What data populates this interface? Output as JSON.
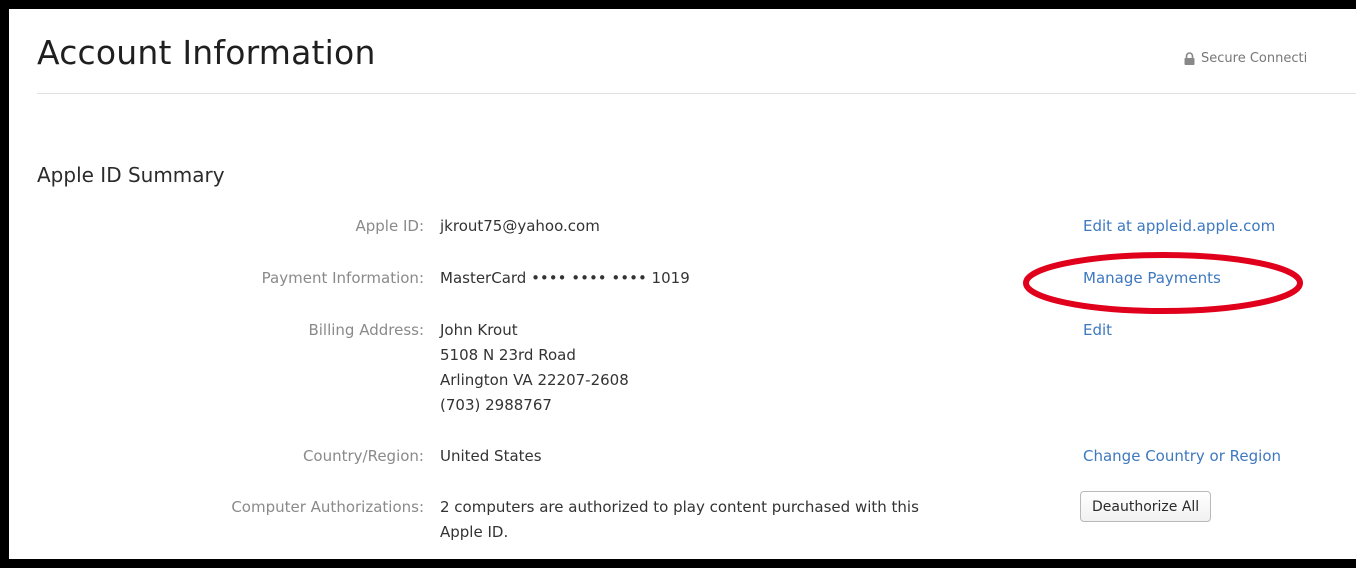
{
  "header": {
    "title": "Account Information",
    "secure_label": "Secure Connecti"
  },
  "summary": {
    "title": "Apple ID Summary",
    "rows": [
      {
        "label": "Apple ID:",
        "value": "jkrout75@yahoo.com",
        "action": "Edit at appleid.apple.com"
      },
      {
        "label": "Payment Information:",
        "value": "MasterCard •••• •••• •••• 1019",
        "action": "Manage Payments"
      },
      {
        "label": "Billing Address:",
        "value_lines": [
          "John Krout",
          "5108 N 23rd Road",
          "Arlington VA 22207-2608",
          "(703) 2988767"
        ],
        "action": "Edit"
      },
      {
        "label": "Country/Region:",
        "value": "United States",
        "action": "Change Country or Region"
      },
      {
        "label": "Computer Authorizations:",
        "value_lines": [
          "2 computers are authorized to play content purchased with this",
          "Apple ID."
        ],
        "action": "Deauthorize All"
      }
    ]
  },
  "icons": {
    "secure": "lock-icon"
  },
  "colors": {
    "link": "#3e78bf",
    "highlight": "#e0001b"
  }
}
